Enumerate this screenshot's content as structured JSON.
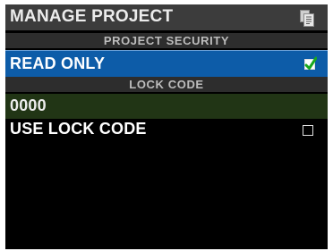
{
  "window": {
    "title": "MANAGE PROJECT",
    "title_icon": "document-icon"
  },
  "sections": {
    "security_header": "PROJECT SECURITY",
    "lock_code_header": "LOCK CODE"
  },
  "items": {
    "read_only": {
      "label": "READ ONLY",
      "checked": true
    },
    "lock_code_value": "0000",
    "use_lock_code": {
      "label": "USE LOCK CODE",
      "checked": false
    }
  },
  "colors": {
    "selected_row": "#0d5ca8",
    "code_row": "#213515",
    "checkmark": "#19a81e"
  }
}
